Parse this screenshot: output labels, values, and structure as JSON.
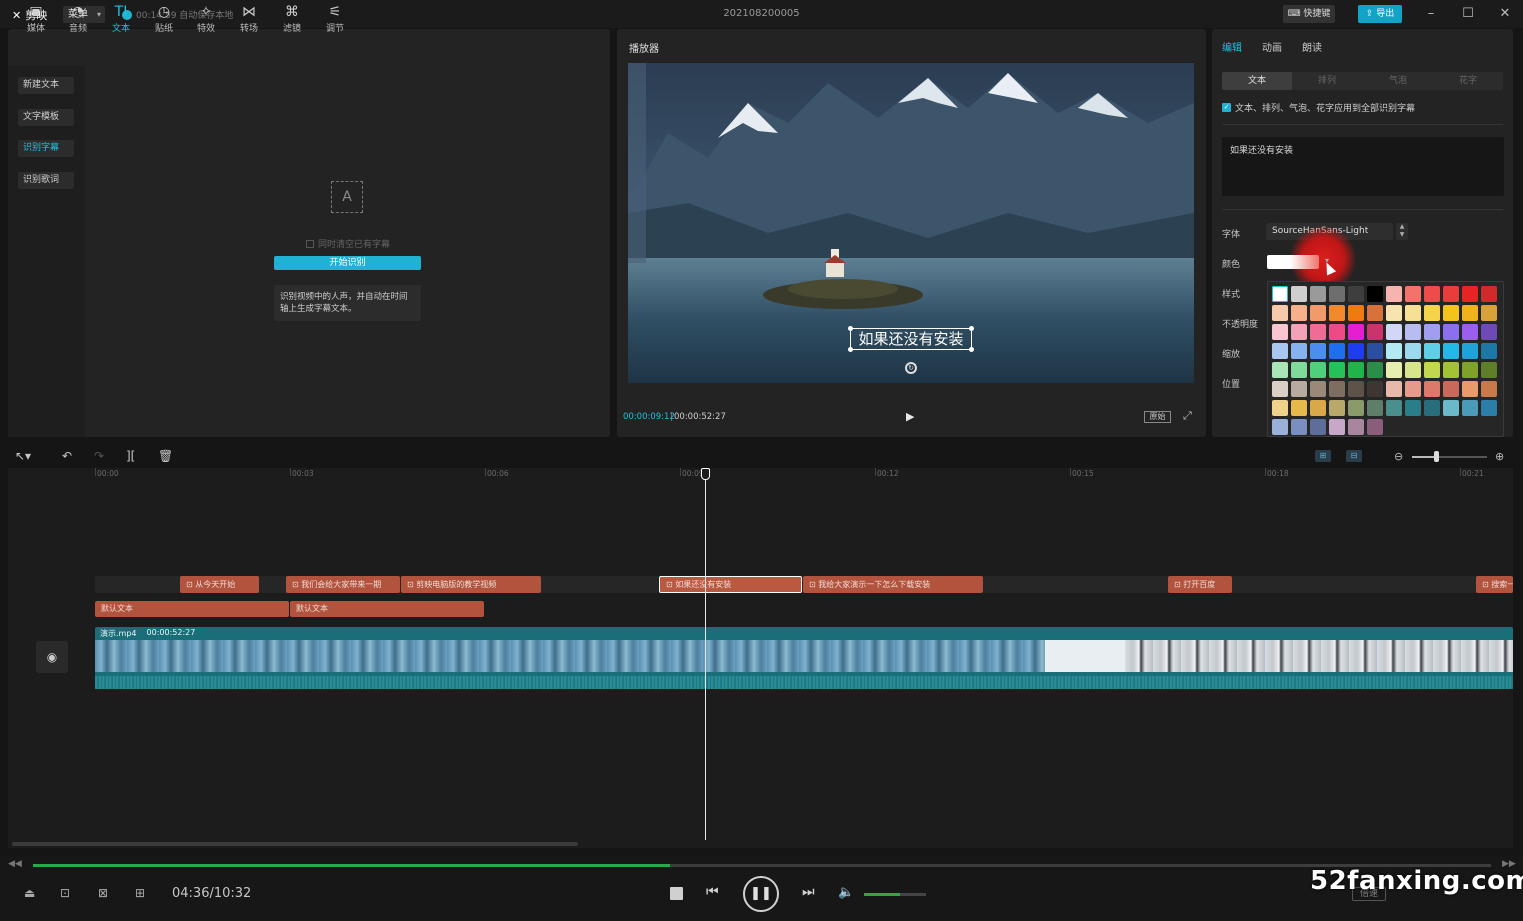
{
  "titlebar": {
    "app_name": "剪映",
    "menu_label": "菜单",
    "autosave": "00:14:59 自动保存本地",
    "project_title": "202108200005",
    "shortcut_label": "快捷键",
    "export_label": "导出"
  },
  "toolbar": {
    "tools": [
      {
        "label": "媒体",
        "icon": "media-icon"
      },
      {
        "label": "音频",
        "icon": "audio-icon"
      },
      {
        "label": "文本",
        "icon": "text-icon"
      },
      {
        "label": "贴纸",
        "icon": "sticker-icon"
      },
      {
        "label": "特效",
        "icon": "effects-icon"
      },
      {
        "label": "转场",
        "icon": "transition-icon"
      },
      {
        "label": "滤镜",
        "icon": "filter-icon"
      },
      {
        "label": "调节",
        "icon": "adjust-icon"
      }
    ]
  },
  "sidebar": {
    "items": [
      "新建文本",
      "文字模板",
      "识别字幕",
      "识别歌词"
    ]
  },
  "recognize": {
    "clear_label": "同时清空已有字幕",
    "start_button": "开始识别",
    "tip": "识别视频中的人声，并自动在时间轴上生成字幕文本。"
  },
  "player": {
    "label": "播放器",
    "subtitle": "如果还没有安装",
    "time_current": "00:00:09:12",
    "time_total": "00:00:52:27",
    "ratio_label": "原始"
  },
  "properties": {
    "tabs": [
      "编辑",
      "动画",
      "朗读"
    ],
    "subtabs": [
      "文本",
      "排列",
      "气泡",
      "花字"
    ],
    "apply_all": "文本、排列、气泡、花字应用到全部识别字幕",
    "text_value": "如果还没有安装",
    "labels": {
      "font": "字体",
      "color": "颜色",
      "style": "样式",
      "opacity": "不透明度",
      "scale": "缩放",
      "position": "位置"
    },
    "font_value": "SourceHanSans-Light",
    "palette": [
      "#ffffff",
      "#cfcfcf",
      "#9a9a9a",
      "#6e6e6e",
      "#3e3e3e",
      "#000000",
      "#f7b3ae",
      "#f3736b",
      "#ef4b4b",
      "#eb3c3c",
      "#e82323",
      "#cf2b2b",
      "#f7c9ab",
      "#f7b08a",
      "#f39a6a",
      "#f08a2d",
      "#ef7a12",
      "#d9723a",
      "#f7e4b0",
      "#f7e096",
      "#f5d34a",
      "#f5c31e",
      "#f0b31d",
      "#d9a13a",
      "#f7c6d2",
      "#f3a3b8",
      "#ef6d93",
      "#ee4a85",
      "#e61ed2",
      "#c8346b",
      "#d2d6f7",
      "#b7bdf3",
      "#a19ef0",
      "#8c6ff0",
      "#9b5ef0",
      "#6d4ab8",
      "#a8c8f0",
      "#86b3f0",
      "#4b8ef0",
      "#1f6ef0",
      "#1e3df0",
      "#2a4fa0",
      "#b3e9f0",
      "#9ad9ee",
      "#5fcfe8",
      "#22b8e8",
      "#1fa3d8",
      "#1d78a8",
      "#a8e6b8",
      "#7fdb9a",
      "#4fd07a",
      "#25c25a",
      "#1fb54a",
      "#2a8e4a",
      "#e6efb0",
      "#d7e68a",
      "#c2d650",
      "#a3c234",
      "#7ea22a",
      "#5e7e2a",
      "#d9cfc6",
      "#b8aa9e",
      "#9a8878",
      "#7e6e62",
      "#5e524a",
      "#3e3632",
      "#e8b8a8",
      "#e69a8a",
      "#d97a6a",
      "#c86a5a",
      "#e89a6a",
      "#c87a4a",
      "#f0d28a",
      "#e8b84a",
      "#d9a84a",
      "#b8a86a",
      "#8a9a6a",
      "#5e7e6a",
      "#4a8e8e",
      "#2a7e8a",
      "#2a6e7e",
      "#6ab8c8",
      "#4a9ab8",
      "#2a7ea8",
      "#9ab0d8",
      "#7a8fc0",
      "#5e6e9a",
      "#c8a8c8",
      "#a8869e",
      "#8a5e7a"
    ],
    "selected_swatch": 0
  },
  "timeline": {
    "ticks": [
      "00:00",
      "00:03",
      "00:06",
      "00:09",
      "00:12",
      "00:15",
      "00:18",
      "00:21"
    ],
    "subtitle_clips": [
      "从今天开始",
      "我们会给大家带来一期",
      "剪映电脑版的教学视频",
      "如果还没有安装",
      "我给大家演示一下怎么下载安装",
      "打开百度",
      "搜索一"
    ],
    "text_clips": [
      "默认文本",
      "默认文本"
    ],
    "main_clip_name": "演示.mp4",
    "main_clip_duration": "00:00:52:27"
  },
  "outer_player": {
    "time": "04:36/10:32",
    "progress": 0.437,
    "volume": 0.58,
    "speed_label": "倍速",
    "watermark": "52fanxing.com"
  },
  "colors": {
    "accent": "#1cc3e3",
    "subtitle_clip": "#b2533d",
    "main_track": "#1a6e78",
    "progress": "#2ea64a"
  }
}
